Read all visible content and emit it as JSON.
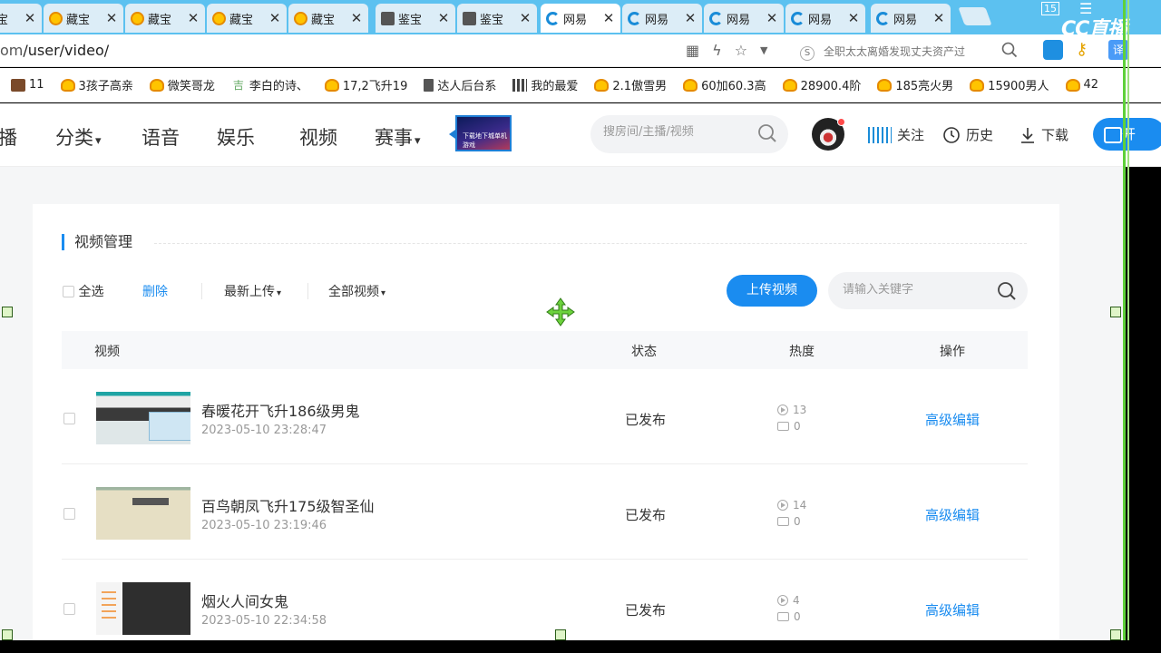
{
  "browser": {
    "tabs": [
      {
        "title": "藏宝",
        "icon": "bili",
        "active": false
      },
      {
        "title": "藏宝",
        "icon": "bili",
        "active": false
      },
      {
        "title": "藏宝",
        "icon": "bili",
        "active": false
      },
      {
        "title": "藏宝",
        "icon": "bili",
        "active": false
      },
      {
        "title": "藏宝",
        "icon": "bili",
        "active": false
      },
      {
        "title": "鉴宝",
        "icon": "doc",
        "active": false
      },
      {
        "title": "鉴宝",
        "icon": "doc",
        "active": false
      },
      {
        "title": "网易",
        "icon": "cc",
        "active": true
      },
      {
        "title": "网易",
        "icon": "cc",
        "active": false
      },
      {
        "title": "网易",
        "icon": "cc",
        "active": false
      },
      {
        "title": "网易",
        "icon": "cc",
        "active": false
      },
      {
        "title": "网易",
        "icon": "cc",
        "active": false
      }
    ],
    "tab_count": "15",
    "watermark": "CC直播",
    "url_prefix": "om",
    "url_path": "/user/video/",
    "news_ticker": "全职太太离婚发现丈夫资产过",
    "translate_label": "译",
    "bookmarks": [
      {
        "label": "11",
        "icon": "img"
      },
      {
        "label": "3孩子高亲",
        "icon": "bili"
      },
      {
        "label": "微笑哥龙",
        "icon": "bili"
      },
      {
        "label": "李白的诗、",
        "icon": "ji"
      },
      {
        "label": "17,2飞升19",
        "icon": "bili"
      },
      {
        "label": "达人后台系",
        "icon": "doc"
      },
      {
        "label": "我的最爱",
        "icon": "grid"
      },
      {
        "label": "2.1傲雪男",
        "icon": "bili"
      },
      {
        "label": "60加60.3高",
        "icon": "bili"
      },
      {
        "label": "28900.4阶",
        "icon": "bili"
      },
      {
        "label": "185亮火男",
        "icon": "bili"
      },
      {
        "label": "15900男人",
        "icon": "bili"
      },
      {
        "label": "42",
        "icon": "bili"
      }
    ]
  },
  "header": {
    "nav": [
      {
        "label": "播",
        "has_caret": false
      },
      {
        "label": "分类",
        "has_caret": true
      },
      {
        "label": "语音",
        "has_caret": false
      },
      {
        "label": "娱乐",
        "has_caret": false
      },
      {
        "label": "视频",
        "has_caret": false
      },
      {
        "label": "赛事",
        "has_caret": true
      }
    ],
    "caret": "▾",
    "banner_text": "下载地下城单机游戏",
    "search_placeholder": "搜房间/主播/视频",
    "follow_label": "关注",
    "history_label": "历史",
    "download_label": "下载",
    "start_label": "开"
  },
  "section": {
    "title": "视频管理",
    "select_all": "全选",
    "delete": "删除",
    "sort": "最新上传",
    "filter": "全部视频",
    "upload_button": "上传视频",
    "keyword_placeholder": "请输入关键字"
  },
  "table": {
    "columns": {
      "video": "视频",
      "status": "状态",
      "heat": "热度",
      "action": "操作"
    },
    "rows": [
      {
        "title": "春暖花开飞升186级男鬼",
        "date": "2023-05-10 23:28:47",
        "status": "已发布",
        "plays": "13",
        "comments": "0",
        "action": "高级编辑",
        "thumb": "t1"
      },
      {
        "title": "百鸟朝凤飞升175级智圣仙",
        "date": "2023-05-10 23:19:46",
        "status": "已发布",
        "plays": "14",
        "comments": "0",
        "action": "高级编辑",
        "thumb": "t2"
      },
      {
        "title": "烟火人间女鬼",
        "date": "2023-05-10 22:34:58",
        "status": "已发布",
        "plays": "4",
        "comments": "0",
        "action": "高级编辑",
        "thumb": "t3"
      }
    ]
  },
  "colors": {
    "accent": "#1a8cf0",
    "tabstrip": "#5cc1f0",
    "overlay_green": "#5fd13a"
  }
}
